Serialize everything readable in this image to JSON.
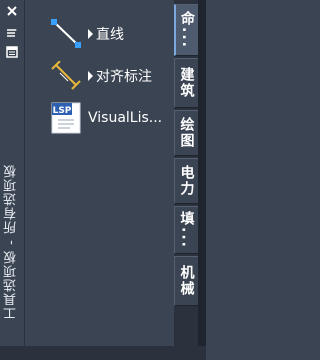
{
  "palette": {
    "title": "工具选项板 - 所有选项板",
    "close_icon": "close-icon",
    "autohide_icon": "autohide-icon",
    "properties_icon": "properties-icon"
  },
  "tools": [
    {
      "label": "直线",
      "icon": "line-tool-icon"
    },
    {
      "label": "对齐标注",
      "icon": "aligned-dimension-icon"
    },
    {
      "label": "VisualLis...",
      "icon": "lsp-file-icon",
      "icon_text": "LSP"
    }
  ],
  "tabs": [
    {
      "label": "命..."
    },
    {
      "label": "建筑"
    },
    {
      "label": "绘图"
    },
    {
      "label": "电力"
    },
    {
      "label": "填..."
    },
    {
      "label": "机械"
    }
  ],
  "colors": {
    "background": "#3b4453",
    "tab_strip": "#2b323d",
    "accent": "#7aa9e0"
  }
}
